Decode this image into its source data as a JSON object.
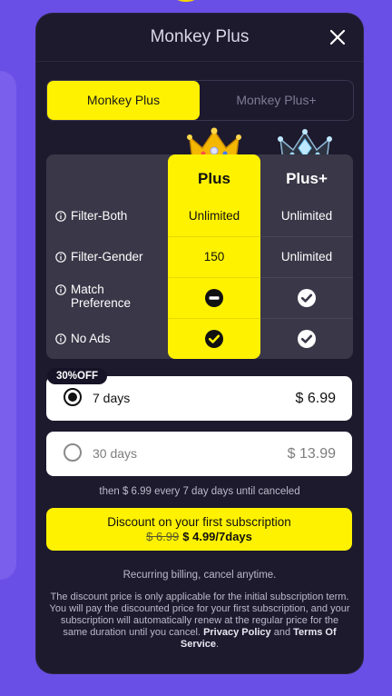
{
  "modal": {
    "title": "Monkey Plus"
  },
  "tabs": [
    {
      "label": "Monkey Plus",
      "active": true
    },
    {
      "label": "Monkey Plus+",
      "active": false
    }
  ],
  "compare": {
    "columns": [
      "Plus",
      "Plus+"
    ],
    "rows": [
      {
        "label": "Filter-Both",
        "plus": "Unlimited",
        "plusplus": "Unlimited"
      },
      {
        "label": "Filter-Gender",
        "plus": "150",
        "plusplus": "Unlimited"
      },
      {
        "label": "Match Preference",
        "plus_icon": "minus-circle-icon",
        "plusplus_icon": "check-circle-icon"
      },
      {
        "label": "No Ads",
        "plus_icon": "check-circle-icon",
        "plusplus_icon": "check-circle-icon"
      }
    ]
  },
  "plans": {
    "badge": "30%OFF",
    "options": [
      {
        "label": "7 days",
        "price": "$ 6.99",
        "selected": true
      },
      {
        "label": "30 days",
        "price": "$ 13.99",
        "selected": false
      }
    ]
  },
  "then_text": "then $ 6.99 every 7 day days until canceled",
  "cta": {
    "line1": "Discount on your first subscription",
    "old_price": "$ 6.99",
    "new_price": "$ 4.99/7days"
  },
  "recurring_text": "Recurring billing, cancel anytime.",
  "disclaimer": {
    "text": "The discount price is only applicable for the initial subscription term. You will pay the discounted price for your first subscription, and your subscription will automatically renew at the regular price for the same duration until you cancel.",
    "privacy_link": "Privacy Policy",
    "and_text": "and",
    "terms_link": "Terms Of Service"
  },
  "colors": {
    "accent_yellow": "#fff200",
    "modal_bg": "#1d1a2e",
    "page_bg": "#6a4fe6"
  }
}
